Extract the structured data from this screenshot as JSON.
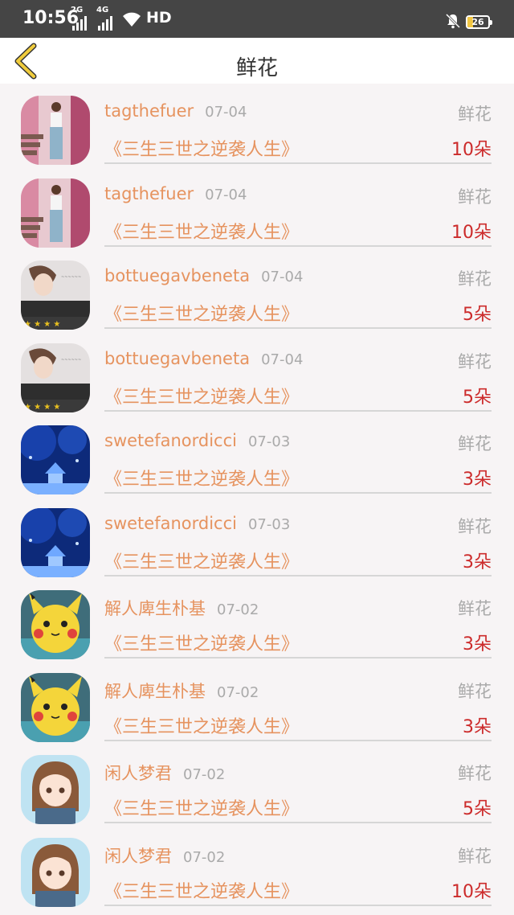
{
  "status_bar": {
    "time": "10:56",
    "network_1": "2G",
    "network_2": "4G",
    "hd": "HD",
    "battery": "26"
  },
  "header": {
    "title": "鲜花"
  },
  "icons": {
    "back": "chevron-left-icon",
    "wifi": "wifi-icon",
    "mute": "bell-off-icon",
    "battery": "battery-icon"
  },
  "colors": {
    "username": "#e6935f",
    "count": "#cc2b2b",
    "muted": "#aaaaaa",
    "back_arrow": "#f0cc3d"
  },
  "items": [
    {
      "avatar": "person-photo-avatar",
      "username": "tagthefuer",
      "date": "07-04",
      "type": "鲜花",
      "show": "《三生三世之逆袭人生》",
      "count": "10朵"
    },
    {
      "avatar": "person-photo-avatar",
      "username": "tagthefuer",
      "date": "07-04",
      "type": "鲜花",
      "show": "《三生三世之逆袭人生》",
      "count": "10朵"
    },
    {
      "avatar": "boy-photo-avatar",
      "username": "bottuegavbeneta",
      "date": "07-04",
      "type": "鲜花",
      "show": "《三生三世之逆袭人生》",
      "count": "5朵"
    },
    {
      "avatar": "boy-photo-avatar",
      "username": "bottuegavbeneta",
      "date": "07-04",
      "type": "鲜花",
      "show": "《三生三世之逆袭人生》",
      "count": "5朵"
    },
    {
      "avatar": "blue-night-avatar",
      "username": "swetefanordicci",
      "date": "07-03",
      "type": "鲜花",
      "show": "《三生三世之逆袭人生》",
      "count": "3朵"
    },
    {
      "avatar": "blue-night-avatar",
      "username": "swetefanordicci",
      "date": "07-03",
      "type": "鲜花",
      "show": "《三生三世之逆袭人生》",
      "count": "3朵"
    },
    {
      "avatar": "pikachu-avatar",
      "username": "解人庳生朴基",
      "date": "07-02",
      "type": "鲜花",
      "show": "《三生三世之逆袭人生》",
      "count": "3朵"
    },
    {
      "avatar": "pikachu-avatar",
      "username": "解人庳生朴基",
      "date": "07-02",
      "type": "鲜花",
      "show": "《三生三世之逆袭人生》",
      "count": "3朵"
    },
    {
      "avatar": "anime-girl-avatar",
      "username": "闲人梦君",
      "date": "07-02",
      "type": "鲜花",
      "show": "《三生三世之逆袭人生》",
      "count": "5朵"
    },
    {
      "avatar": "anime-girl-avatar",
      "username": "闲人梦君",
      "date": "07-02",
      "type": "鲜花",
      "show": "《三生三世之逆袭人生》",
      "count": "10朵"
    }
  ]
}
